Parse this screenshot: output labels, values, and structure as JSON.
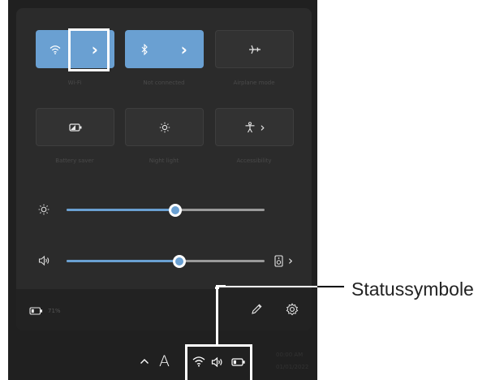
{
  "quick_settings": {
    "tiles": [
      {
        "id": "wifi",
        "label": "Wi-Fi",
        "on": true,
        "icon": "wifi-icon",
        "has_arrow": true
      },
      {
        "id": "bluetooth",
        "label": "Not connected",
        "on": true,
        "icon": "bluetooth-icon",
        "has_arrow": true
      },
      {
        "id": "airplane",
        "label": "Airplane mode",
        "on": false,
        "icon": "airplane-icon"
      },
      {
        "id": "battery-saver",
        "label": "Battery saver",
        "on": false,
        "icon": "battery-saver-icon"
      },
      {
        "id": "night-light",
        "label": "Night light",
        "on": false,
        "icon": "night-light-icon"
      },
      {
        "id": "accessibility",
        "label": "Accessibility",
        "on": false,
        "icon": "accessibility-icon",
        "has_arrow": true
      }
    ],
    "chevron": "›",
    "brightness": {
      "icon": "brightness-icon",
      "level": 0.55
    },
    "volume": {
      "icon": "speaker-icon",
      "level": 0.57,
      "output_icon": "speaker-device-icon"
    },
    "footer": {
      "battery_text": "71%",
      "edit_icon": "pencil-icon",
      "settings_icon": "gear-icon"
    }
  },
  "taskbar": {
    "overflow_icon": "chevron-up-icon",
    "input_indicator": "A",
    "status_icons": [
      "wifi-icon",
      "volume-icon",
      "battery-icon"
    ],
    "clock_time": "00:00 AM",
    "clock_date": "01/01/2022"
  },
  "callout": {
    "label": "Statussymbole"
  },
  "colors": {
    "accent": "#6aa0d2",
    "panel": "#2b2b2b",
    "taskbar": "#202020"
  }
}
